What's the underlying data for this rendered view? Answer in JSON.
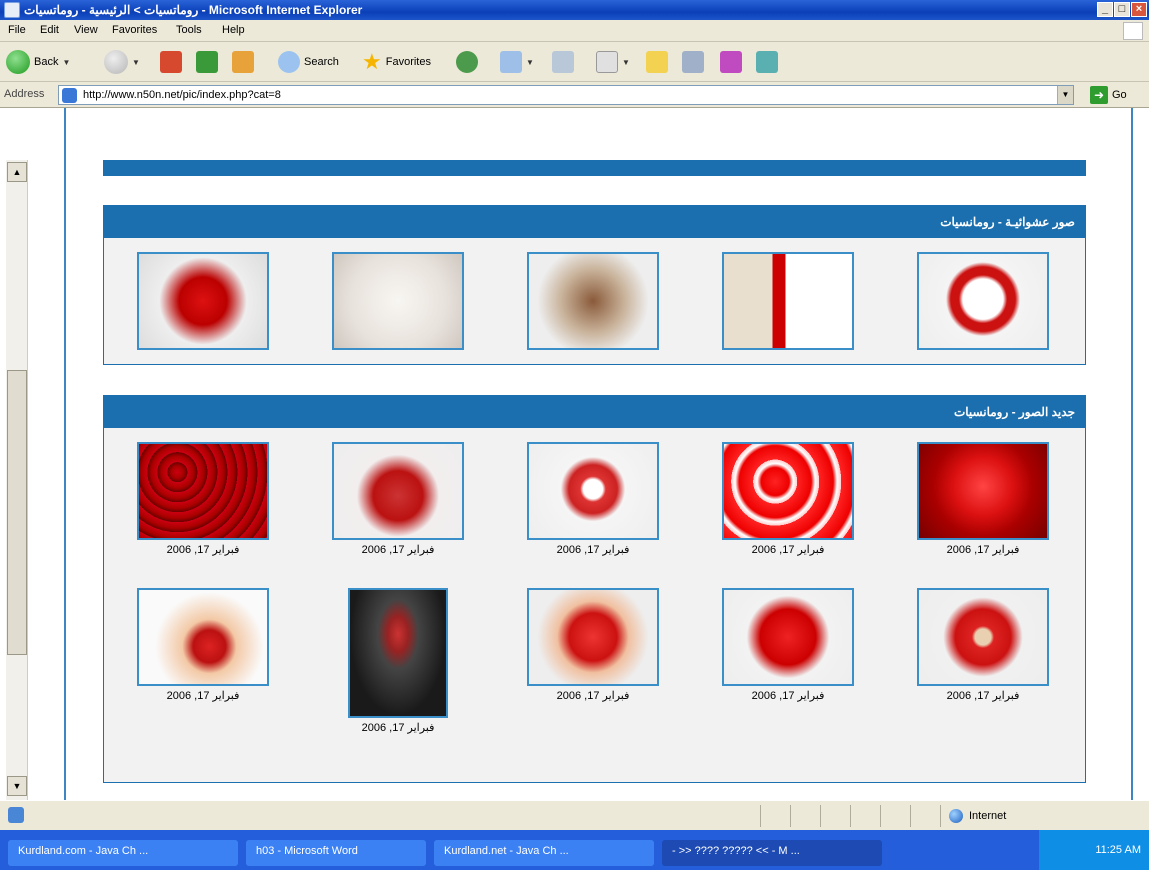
{
  "window": {
    "title": "روماتسيات > الرئيسية - روماتسيات - Microsoft Internet Explorer",
    "buttons": [
      "_",
      "□",
      "×"
    ]
  },
  "menu": [
    "File",
    "Edit",
    "View",
    "Favorites",
    "Tools",
    "Help"
  ],
  "toolbar": {
    "back": "Back",
    "search": "Search",
    "favorites": "Favorites"
  },
  "address": {
    "label": "Address",
    "url": "http://www.n50n.net/pic/index.php?cat=8",
    "go": "Go"
  },
  "random_panel": {
    "title": "صور عشوائيـة - رومانسيات"
  },
  "new_panel": {
    "title": "جديد الصور - رومانسيات",
    "captions": [
      "فبراير 17, 2006",
      "فبراير 17, 2006",
      "فبراير 17, 2006",
      "فبراير 17, 2006",
      "فبراير 17, 2006",
      "فبراير 17, 2006",
      "فبراير 17, 2006",
      "فبراير 17, 2006",
      "فبراير 17, 2006",
      "فبراير 17, 2006"
    ]
  },
  "status": {
    "zone": "Internet"
  },
  "taskbar": {
    "buttons": [
      "Kurdland.com - Java Ch ...",
      "h03 - Microsoft Word",
      "Kurdland.net - Java Ch ...",
      "- >> ???? ????? << - M ..."
    ],
    "clock": "11:25 AM"
  }
}
